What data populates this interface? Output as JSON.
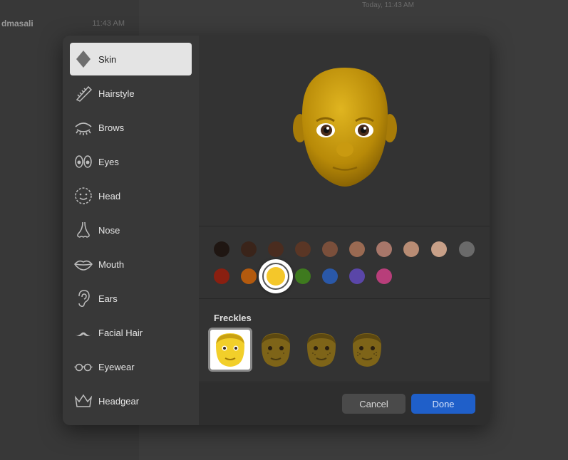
{
  "background": {
    "contact_name": "dmasali",
    "contact_time": "11:43 AM",
    "conversation_date": "Today, 11:43 AM"
  },
  "sidebar": {
    "items": [
      {
        "label": "Skin",
        "icon": "diamond-icon",
        "active": true
      },
      {
        "label": "Hairstyle",
        "icon": "comb-icon",
        "active": false
      },
      {
        "label": "Brows",
        "icon": "brows-icon",
        "active": false
      },
      {
        "label": "Eyes",
        "icon": "eyes-icon",
        "active": false
      },
      {
        "label": "Head",
        "icon": "head-icon",
        "active": false
      },
      {
        "label": "Nose",
        "icon": "nose-icon",
        "active": false
      },
      {
        "label": "Mouth",
        "icon": "mouth-icon",
        "active": false
      },
      {
        "label": "Ears",
        "icon": "ear-icon",
        "active": false
      },
      {
        "label": "Facial Hair",
        "icon": "mustache-icon",
        "active": false
      },
      {
        "label": "Eyewear",
        "icon": "glasses-icon",
        "active": false
      },
      {
        "label": "Headgear",
        "icon": "crown-icon",
        "active": false
      }
    ]
  },
  "skin_colors": {
    "row1": [
      "#1f1612",
      "#3a241a",
      "#4a2c1f",
      "#5a3625",
      "#7a4f3b",
      "#9a6a52",
      "#a8776a",
      "#b88c74",
      "#c8a088",
      "#6a6a6a"
    ],
    "row2": [
      "#8a1f10",
      "#b35a0e",
      "#f4c72a",
      "#3e7a1e",
      "#2a58a8",
      "#5a46a8",
      "#b83e7a"
    ],
    "selected_index_row2": 2
  },
  "freckles": {
    "label": "Freckles",
    "options": [
      {
        "name": "none",
        "selected": true
      },
      {
        "name": "light",
        "selected": false
      },
      {
        "name": "medium",
        "selected": false
      },
      {
        "name": "heavy",
        "selected": false
      }
    ]
  },
  "footer": {
    "cancel_label": "Cancel",
    "done_label": "Done"
  }
}
